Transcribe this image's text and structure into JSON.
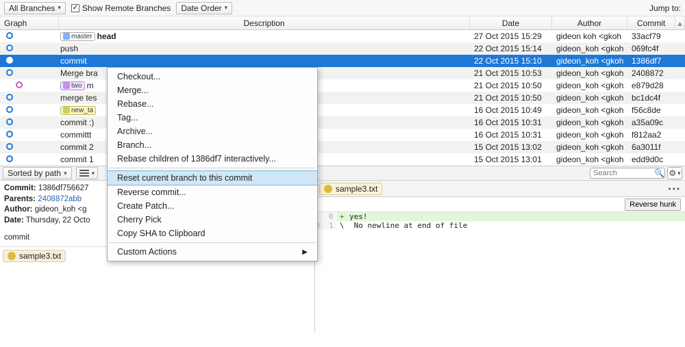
{
  "toolbar": {
    "branch_filter": "All Branches",
    "show_remote_label": "Show Remote Branches",
    "order_filter": "Date Order",
    "jump_label": "Jump to:"
  },
  "headers": {
    "graph": "Graph",
    "description": "Description",
    "date": "Date",
    "author": "Author",
    "commit": "Commit"
  },
  "commits": [
    {
      "badge_master": "master",
      "desc_bold": "head",
      "date": "27 Oct 2015 15:29",
      "author": "gideon koh  <gkoh",
      "hash": "33acf79"
    },
    {
      "desc": "push",
      "date": "22 Oct 2015 15:14",
      "author": "gideon_koh  <gkoh",
      "hash": "069fc4f"
    },
    {
      "desc": "commit",
      "date": "22 Oct 2015 15:10",
      "author": "gideon_koh  <gkoh",
      "hash": "1386df7",
      "selected": true
    },
    {
      "desc": "Merge bra",
      "date": "21 Oct 2015 10:53",
      "author": "gideon_koh  <gkoh",
      "hash": "2408872"
    },
    {
      "badge_branch": "two",
      "desc": "m",
      "date": "21 Oct 2015 10:50",
      "author": "gideon_koh  <gkoh",
      "hash": "e879d28"
    },
    {
      "desc": "merge tes",
      "date": "21 Oct 2015 10:50",
      "author": "gideon_koh  <gkoh",
      "hash": "bc1dc4f"
    },
    {
      "badge_tag": "new_ta",
      "date": "16 Oct 2015 10:49",
      "author": "gideon_koh  <gkoh",
      "hash": "f56c8de"
    },
    {
      "desc": "commit :)",
      "date": "16 Oct 2015 10:31",
      "author": "gideon_koh  <gkoh",
      "hash": "a35a09c"
    },
    {
      "desc": "committt",
      "date": "16 Oct 2015 10:31",
      "author": "gideon_koh  <gkoh",
      "hash": "f812aa2"
    },
    {
      "desc": "commit 2",
      "date": "15 Oct 2015 13:02",
      "author": "gideon_koh  <gkoh",
      "hash": "6a3011f"
    },
    {
      "desc": "commit 1",
      "date": "15 Oct 2015 13:01",
      "author": "gideon_koh  <gkoh",
      "hash": "edd9d0c"
    }
  ],
  "context_menu": {
    "items": [
      {
        "label": "Checkout..."
      },
      {
        "label": "Merge..."
      },
      {
        "label": "Rebase..."
      },
      {
        "label": "Tag..."
      },
      {
        "label": "Archive..."
      },
      {
        "label": "Branch..."
      },
      {
        "label": "Rebase children of 1386df7 interactively..."
      },
      {
        "sep": true
      },
      {
        "label": "Reset current branch to this commit",
        "selected": true
      },
      {
        "label": "Reverse commit..."
      },
      {
        "label": "Create Patch..."
      },
      {
        "label": "Cherry Pick"
      },
      {
        "label": "Copy SHA to Clipboard"
      },
      {
        "sep": true
      },
      {
        "label": "Custom Actions",
        "submenu": true
      }
    ]
  },
  "middle": {
    "sort_label": "Sorted by path",
    "search_placeholder": "Search"
  },
  "details": {
    "commit_label": "Commit:",
    "commit_value": "1386df756627",
    "parents_label": "Parents:",
    "parents_value": "2408872abb",
    "author_label": "Author:",
    "author_value": "gideon_koh  <g",
    "date_label": "Date:",
    "date_value": "Thursday, 22 Octo",
    "message": "commit",
    "file": "sample3.txt"
  },
  "diff": {
    "filename": "sample3.txt",
    "reverse_hunk": "Reverse hunk",
    "lines": [
      {
        "gutter": "   0",
        "mark": "+",
        "text": "yes!",
        "add": true
      },
      {
        "gutter": "0  1",
        "mark": "\\",
        "text": " No newline at end of file"
      }
    ]
  }
}
